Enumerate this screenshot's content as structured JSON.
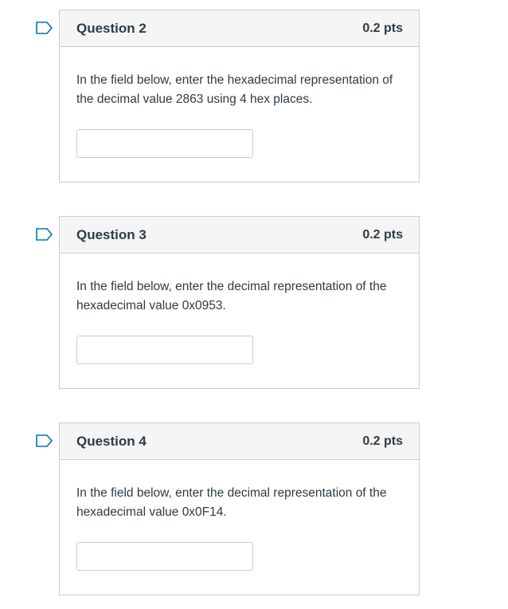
{
  "questions": [
    {
      "title": "Question 2",
      "points": "0.2 pts",
      "text": "In the field below, enter the hexadecimal representation of the decimal value 2863 using 4 hex places.",
      "answer_value": ""
    },
    {
      "title": "Question 3",
      "points": "0.2 pts",
      "text": "In the field below, enter the decimal representation of the hexadecimal value 0x0953.",
      "answer_value": ""
    },
    {
      "title": "Question 4",
      "points": "0.2 pts",
      "text": "In the field below, enter the decimal representation of the hexadecimal value 0x0F14.",
      "answer_value": ""
    }
  ],
  "icons": {
    "flag": "flag-icon"
  },
  "colors": {
    "border": "#c7cdd1",
    "header_bg": "#f5f5f5",
    "text": "#2d3b45",
    "flag_accent": "#0374b5"
  }
}
